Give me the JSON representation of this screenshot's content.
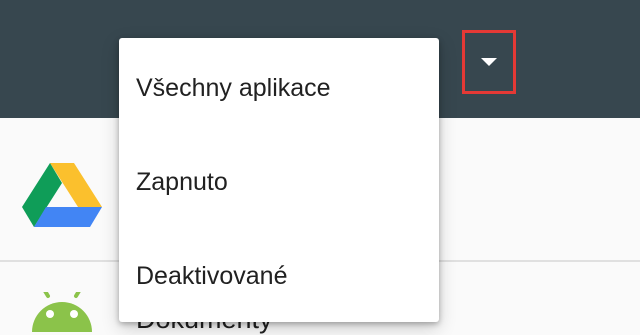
{
  "appbar": {
    "color": "#37474f",
    "dropdown_icon": "arrow-drop-down-icon",
    "highlight_color": "#e53935"
  },
  "menu": {
    "items": [
      {
        "label": "Všechny aplikace"
      },
      {
        "label": "Zapnuto"
      },
      {
        "label": "Deaktivované"
      }
    ]
  },
  "list": {
    "rows": [
      {
        "icon": "google-drive-icon",
        "label": ""
      },
      {
        "icon": "android-icon",
        "label": "Dokumenty"
      }
    ]
  }
}
